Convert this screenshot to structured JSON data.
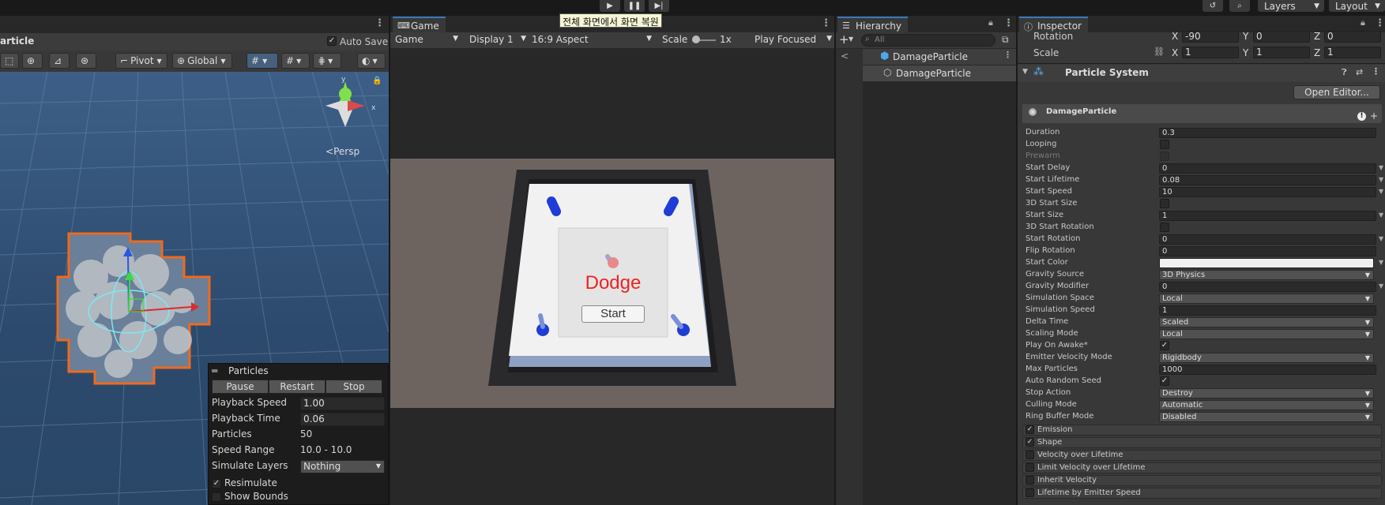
{
  "toolbar": {
    "layers_label": "Layers",
    "layout_label": "Layout",
    "tooltip": "전체 화면에서 화면 복원"
  },
  "scene": {
    "title": "article",
    "auto_save_label": "Auto Save",
    "pivot_label": "Pivot",
    "global_label": "Global",
    "persp_label": "Persp",
    "particles_panel": {
      "title": "Particles",
      "pause": "Pause",
      "restart": "Restart",
      "stop": "Stop",
      "rows": [
        {
          "label": "Playback Speed",
          "value": "1.00"
        },
        {
          "label": "Playback Time",
          "value": "0.06"
        },
        {
          "label": "Particles",
          "value": "50"
        },
        {
          "label": "Speed Range",
          "value": "10.0 - 10.0"
        }
      ],
      "simulate_layers_label": "Simulate Layers",
      "simulate_layers_value": "Nothing",
      "resimulate_label": "Resimulate",
      "show_bounds_label": "Show Bounds"
    }
  },
  "game": {
    "tab": "Game",
    "mode": "Game",
    "display": "Display 1",
    "aspect": "16:9 Aspect",
    "scale_label": "Scale",
    "scale_value": "1x",
    "play_focused": "Play Focused",
    "title_text": "Dodge",
    "start_button": "Start"
  },
  "hierarchy": {
    "tab": "Hierarchy",
    "search_placeholder": "All",
    "root": "DamageParticle",
    "child": "DamageParticle"
  },
  "inspector": {
    "tab": "Inspector",
    "rotation_label": "Rotation",
    "rotation": {
      "x": "-90",
      "y": "0",
      "z": "0"
    },
    "scale_label": "Scale",
    "scale": {
      "x": "1",
      "y": "1",
      "z": "1"
    },
    "component_title": "Particle System",
    "open_editor": "Open Editor...",
    "module_name": "DamageParticle",
    "props": [
      {
        "label": "Duration",
        "kind": "value",
        "value": "0.3"
      },
      {
        "label": "Looping",
        "kind": "check",
        "value": ""
      },
      {
        "label": "Prewarm",
        "kind": "check",
        "value": "",
        "disabled": true
      },
      {
        "label": "Start Delay",
        "kind": "value",
        "value": "0",
        "arrow": true
      },
      {
        "label": "Start Lifetime",
        "kind": "value",
        "value": "0.08",
        "arrow": true
      },
      {
        "label": "Start Speed",
        "kind": "value",
        "value": "10",
        "arrow": true
      },
      {
        "label": "3D Start Size",
        "kind": "check",
        "value": ""
      },
      {
        "label": "Start Size",
        "kind": "value",
        "value": "1",
        "arrow": true
      },
      {
        "label": "3D Start Rotation",
        "kind": "check",
        "value": ""
      },
      {
        "label": "Start Rotation",
        "kind": "value",
        "value": "0",
        "arrow": true
      },
      {
        "label": "Flip Rotation",
        "kind": "value",
        "value": "0"
      },
      {
        "label": "Start Color",
        "kind": "color",
        "value": "",
        "arrow": true
      },
      {
        "label": "Gravity Source",
        "kind": "dropdown",
        "value": "3D Physics"
      },
      {
        "label": "Gravity Modifier",
        "kind": "value",
        "value": "0",
        "arrow": true
      },
      {
        "label": "Simulation Space",
        "kind": "dropdown",
        "value": "Local"
      },
      {
        "label": "Simulation Speed",
        "kind": "value",
        "value": "1"
      },
      {
        "label": "Delta Time",
        "kind": "dropdown",
        "value": "Scaled"
      },
      {
        "label": "Scaling Mode",
        "kind": "dropdown",
        "value": "Local"
      },
      {
        "label": "Play On Awake*",
        "kind": "check",
        "value": "✓"
      },
      {
        "label": "Emitter Velocity Mode",
        "kind": "dropdown",
        "value": "Rigidbody"
      },
      {
        "label": "Max Particles",
        "kind": "value",
        "value": "1000"
      },
      {
        "label": "Auto Random Seed",
        "kind": "check",
        "value": "✓"
      },
      {
        "label": "Stop Action",
        "kind": "dropdown",
        "value": "Destroy"
      },
      {
        "label": "Culling Mode",
        "kind": "dropdown",
        "value": "Automatic"
      },
      {
        "label": "Ring Buffer Mode",
        "kind": "dropdown",
        "value": "Disabled"
      }
    ],
    "modules": [
      {
        "label": "Emission",
        "checked": "✓"
      },
      {
        "label": "Shape",
        "checked": "✓"
      },
      {
        "label": "Velocity over Lifetime",
        "checked": ""
      },
      {
        "label": "Limit Velocity over Lifetime",
        "checked": ""
      },
      {
        "label": "Inherit Velocity",
        "checked": ""
      },
      {
        "label": "Lifetime by Emitter Speed",
        "checked": ""
      }
    ]
  }
}
